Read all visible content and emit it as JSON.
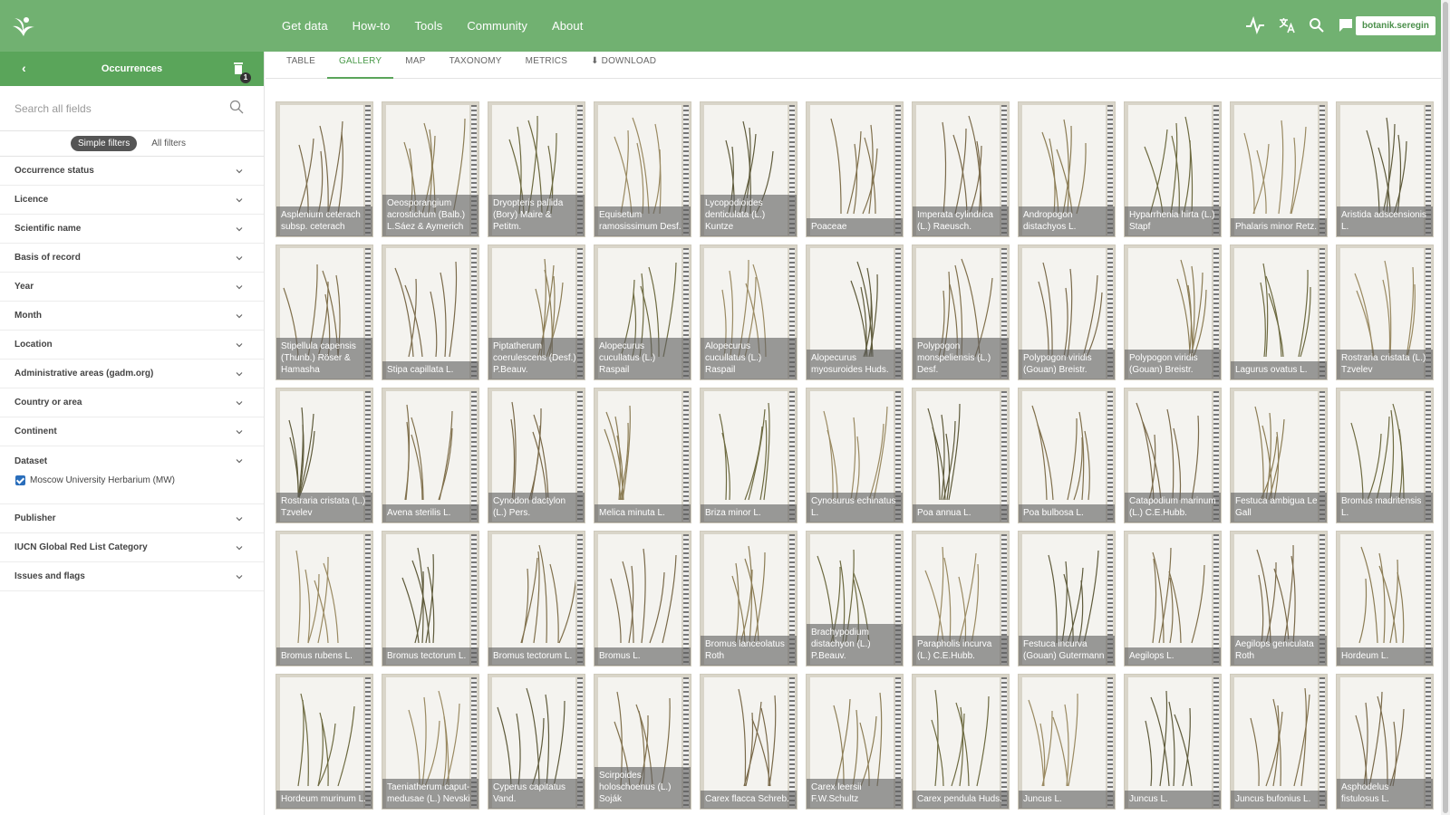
{
  "nav": [
    "Get data",
    "How-to",
    "Tools",
    "Community",
    "About"
  ],
  "user": "botanik.seregin",
  "sidebar": {
    "title": "Occurrences",
    "badge": "1",
    "search_placeholder": "Search all fields",
    "tabs": [
      "Simple filters",
      "All filters"
    ],
    "filters": [
      "Occurrence status",
      "Licence",
      "Scientific name",
      "Basis of record",
      "Year",
      "Month",
      "Location",
      "Administrative areas (gadm.org)",
      "Country or area",
      "Continent"
    ],
    "dataset_label": "Dataset",
    "dataset_value": "Moscow University Herbarium (MW)",
    "filters_after": [
      "Publisher",
      "IUCN Global Red List Category",
      "Issues and flags"
    ]
  },
  "content_tabs": [
    "TABLE",
    "GALLERY",
    "MAP",
    "TAXONOMY",
    "METRICS",
    "DOWNLOAD"
  ],
  "active_tab": "GALLERY",
  "gallery": [
    "Asplenium ceterach subsp. ceterach",
    "Oeosporangium acrostichum (Balb.) L.Sáez & Aymerich",
    "Dryopteris pallida (Bory) Maire & Petitm.",
    "Equisetum ramosissimum Desf.",
    "Lycopodioides denticulata (L.) Kuntze",
    "Poaceae",
    "Imperata cylindrica (L.) Raeusch.",
    "Andropogon distachyos L.",
    "Hyparrhenia hirta (L.) Stapf",
    "Phalaris minor Retz.",
    "Aristida adscensionis L.",
    "Stipellula capensis (Thunb.) Röser & Hamasha",
    "Stipa capillata L.",
    "Piptatherum coerulescens (Desf.) P.Beauv.",
    "Alopecurus cucullatus (L.) Raspail",
    "Alopecurus cucullatus (L.) Raspail",
    "Alopecurus myosuroides Huds.",
    "Polypogon monspeliensis (L.) Desf.",
    "Polypogon viridis (Gouan) Breistr.",
    "Polypogon viridis (Gouan) Breistr.",
    "Lagurus ovatus L.",
    "Rostraria cristata (L.) Tzvelev",
    "Rostraria cristata (L.) Tzvelev",
    "Avena sterilis L.",
    "Cynodon dactylon (L.) Pers.",
    "Melica minuta L.",
    "Briza minor L.",
    "Cynosurus echinatus L.",
    "Poa annua L.",
    "Poa bulbosa L.",
    "Catapodium marinum (L.) C.E.Hubb.",
    "Festuca ambigua Le Gall",
    "Bromus madritensis L.",
    "Bromus rubens L.",
    "Bromus tectorum L.",
    "Bromus tectorum L.",
    "Bromus L.",
    "Bromus lanceolatus Roth",
    "Brachypodium distachyon (L.) P.Beauv.",
    "Parapholis incurva (L.) C.E.Hubb.",
    "Festuca incurva (Gouan) Gutermann",
    "Aegilops L.",
    "Aegilops geniculata Roth",
    "Hordeum L.",
    "Hordeum murinum L.",
    "Taeniatherum caput-medusae (L.) Nevski",
    "Cyperus capitatus Vand.",
    "Scirpoides holoschoenus (L.) Soják",
    "Carex flacca Schreb.",
    "Carex leersii F.W.Schultz",
    "Carex pendula Huds.",
    "Juncus L.",
    "Juncus L.",
    "Juncus bufonius L.",
    "Asphodelus fistulosus L."
  ],
  "colors": {
    "header": "#71b171",
    "accent": "#5aa55a"
  }
}
